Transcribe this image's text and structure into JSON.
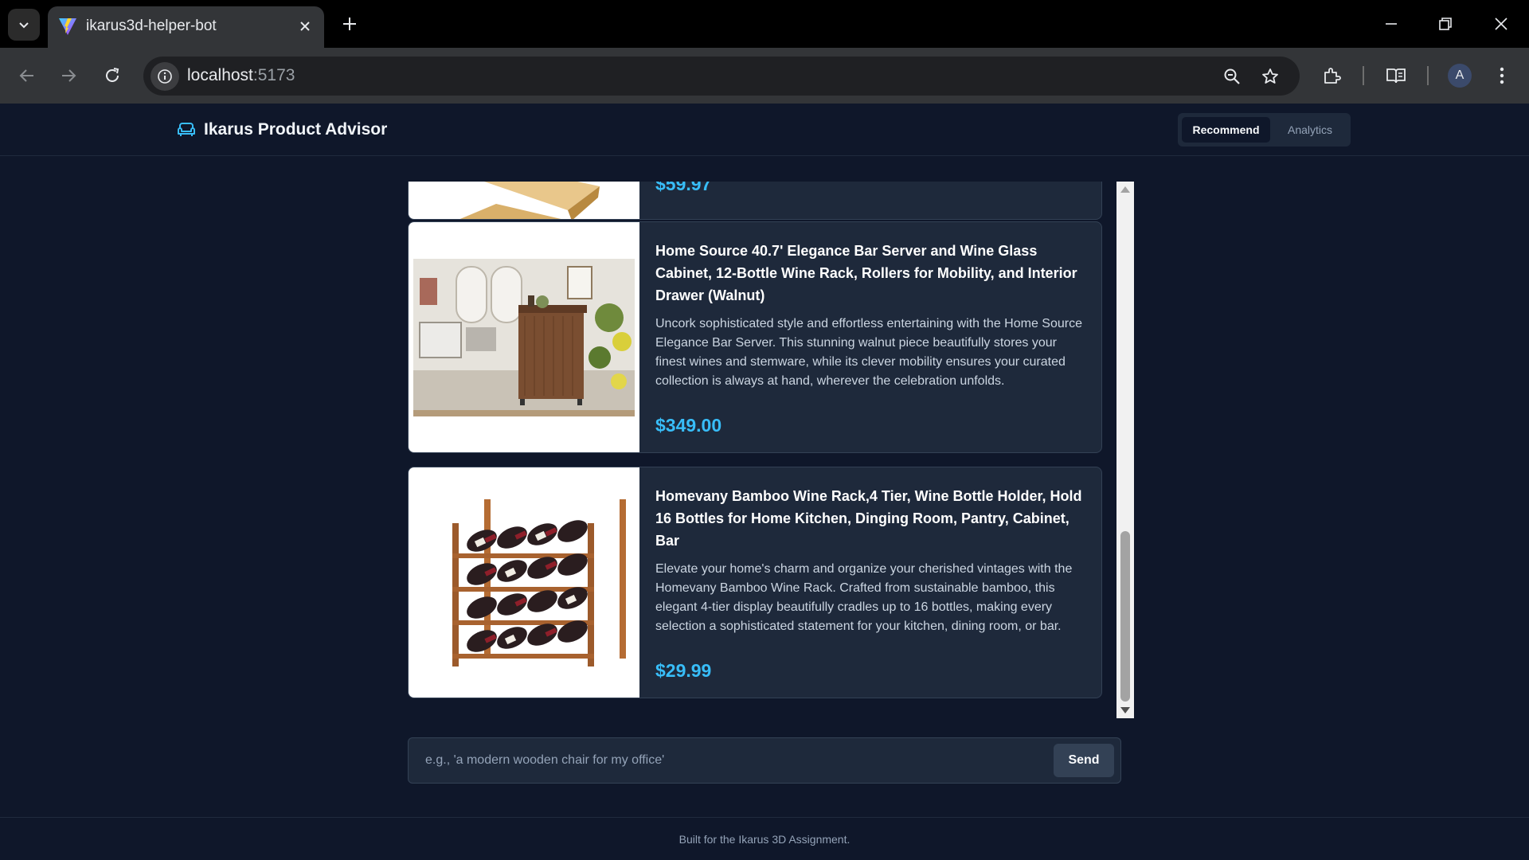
{
  "browser": {
    "tab_title": "ikarus3d-helper-bot",
    "url_host": "localhost",
    "url_port": ":5173",
    "profile_initial": "A"
  },
  "app": {
    "brand": "Ikarus Product Advisor",
    "tabs": [
      {
        "label": "Recommend",
        "active": true
      },
      {
        "label": "Analytics",
        "active": false
      }
    ]
  },
  "results": [
    {
      "title": "",
      "description": "",
      "price": "$59.97",
      "partially_visible": true
    },
    {
      "title": "Home Source 40.7' Elegance Bar Server and Wine Glass Cabinet, 12-Bottle Wine Rack, Rollers for Mobility, and Interior Drawer (Walnut)",
      "description": "Uncork sophisticated style and effortless entertaining with the Home Source Elegance Bar Server. This stunning walnut piece beautifully stores your finest wines and stemware, while its clever mobility ensures your curated collection is always at hand, wherever the celebration unfolds.",
      "price": "$349.00",
      "image": "walnut-bar-cabinet"
    },
    {
      "title": "Homevany Bamboo Wine Rack,4 Tier, Wine Bottle Holder, Hold 16 Bottles for Home Kitchen, Dinging Room, Pantry, Cabinet, Bar",
      "description": "Elevate your home's charm and organize your cherished vintages with the Homevany Bamboo Wine Rack. Crafted from sustainable bamboo, this elegant 4-tier display beautifully cradles up to 16 bottles, making every selection a sophisticated statement for your kitchen, dining room, or bar.",
      "price": "$29.99",
      "image": "bamboo-wine-rack"
    }
  ],
  "composer": {
    "placeholder": "e.g., 'a modern wooden chair for my office'",
    "send_label": "Send"
  },
  "footer": {
    "text": "Built for the Ikarus 3D Assignment."
  },
  "colors": {
    "page_bg": "#0f172a",
    "card_bg": "#1e293b",
    "price": "#38bdf8",
    "brand_icon": "#38bdf8"
  }
}
